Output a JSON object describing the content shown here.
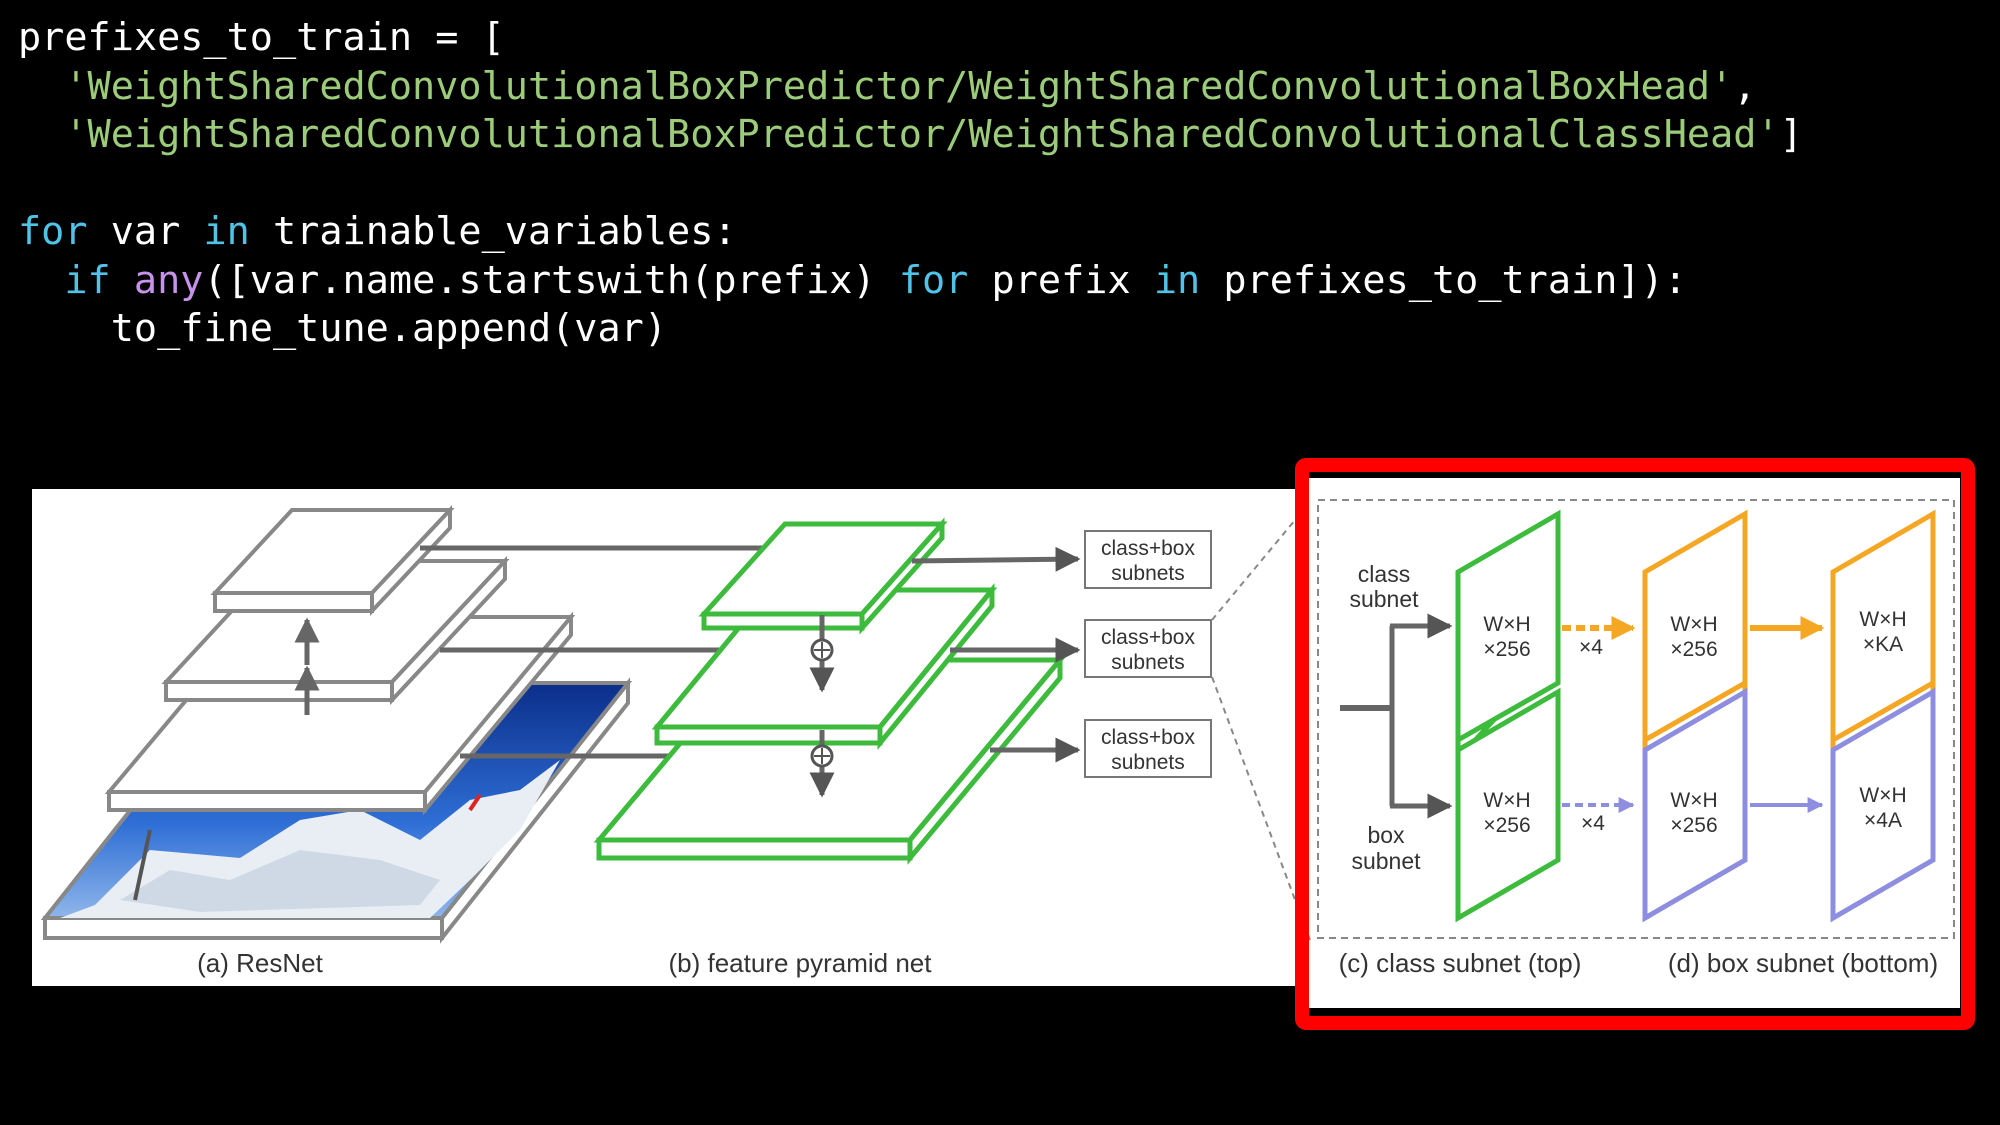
{
  "code": {
    "line1": {
      "name": "prefixes_to_train",
      "op": " = ["
    },
    "line2": {
      "indent": "  ",
      "str": "'WeightSharedConvolutionalBoxPredictor/WeightSharedConvolutionalBoxHead'",
      "tail": ","
    },
    "line3": {
      "indent": "  ",
      "str": "'WeightSharedConvolutionalBoxPredictor/WeightSharedConvolutionalClassHead'",
      "tail": "]"
    },
    "line5": {
      "kw_for": "for",
      "var": " var ",
      "kw_in": "in",
      "rest": " trainable_variables:"
    },
    "line6": {
      "indent": "  ",
      "kw_if": "if",
      "sp": " ",
      "fn_any": "any",
      "mid": "([var.name.startswith(prefix) ",
      "kw_for": "for",
      "mid2": " prefix ",
      "kw_in": "in",
      "rest": " prefixes_to_train]):"
    },
    "line7": {
      "indent": "    ",
      "text": "to_fine_tune.append(var)"
    }
  },
  "diagram": {
    "subnet_label_1": [
      "class+box",
      "subnets"
    ],
    "subnet_label_2": [
      "class+box",
      "subnets"
    ],
    "subnet_label_3": [
      "class+box",
      "subnets"
    ],
    "caption_a": "(a) ResNet",
    "caption_b": "(b) feature pyramid net",
    "caption_c": "(c) class subnet (top)",
    "caption_d": "(d) box subnet (bottom)",
    "class_subnet_label": [
      "class",
      "subnet"
    ],
    "box_subnet_label": [
      "box",
      "subnet"
    ],
    "class_block_1": [
      "W×H",
      "×256"
    ],
    "class_block_2": [
      "W×H",
      "×256"
    ],
    "class_block_out": [
      "W×H",
      "×KA"
    ],
    "box_block_1": [
      "W×H",
      "×256"
    ],
    "box_block_2": [
      "W×H",
      "×256"
    ],
    "box_block_out": [
      "W×H",
      "×4A"
    ],
    "repeat_class": "×4",
    "repeat_box": "×4"
  },
  "colors": {
    "green": "#3dbb3d",
    "orange": "#f5a623",
    "purple": "#8e8ee0",
    "gray": "#777777",
    "highlight": "#ff0000",
    "string": "#9ccc7a",
    "keyword": "#4fc3e8",
    "function": "#c792ea"
  }
}
